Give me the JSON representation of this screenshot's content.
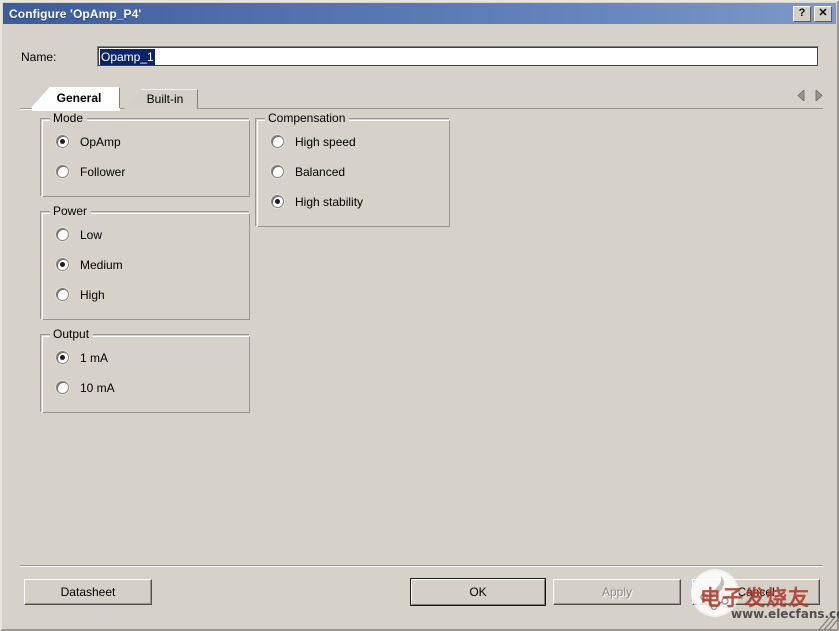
{
  "window": {
    "title": "Configure 'OpAmp_P4'",
    "help_button": "?",
    "close_button": "✕"
  },
  "name_field": {
    "label": "Name:",
    "value": "Opamp_1",
    "placeholder": "Opamp_1"
  },
  "tabs": [
    {
      "label": "General",
      "active": true
    },
    {
      "label": "Built-in",
      "active": false
    }
  ],
  "tab_nav": {
    "prev_icon": "left-triangle-icon",
    "next_icon": "right-triangle-icon"
  },
  "groups": {
    "mode": {
      "title": "Mode",
      "options": [
        {
          "label": "OpAmp",
          "selected": true
        },
        {
          "label": "Follower",
          "selected": false
        }
      ]
    },
    "power": {
      "title": "Power",
      "options": [
        {
          "label": "Low",
          "selected": false
        },
        {
          "label": "Medium",
          "selected": true
        },
        {
          "label": "High",
          "selected": false
        }
      ]
    },
    "output": {
      "title": "Output",
      "options": [
        {
          "label": "1 mA",
          "selected": true
        },
        {
          "label": "10 mA",
          "selected": false
        }
      ]
    },
    "compensation": {
      "title": "Compensation",
      "options": [
        {
          "label": "High speed",
          "selected": false
        },
        {
          "label": "Balanced",
          "selected": false
        },
        {
          "label": "High stability",
          "selected": true
        }
      ]
    }
  },
  "buttons": {
    "datasheet": "Datasheet",
    "ok": "OK",
    "apply": "Apply",
    "cancel": "Cancel"
  },
  "watermark": {
    "cn_text": "电子发烧友",
    "url_text": "www.elecfans.com"
  },
  "colors": {
    "titlebar_start": "#3c5c9c",
    "titlebar_end": "#7d99c9",
    "dialog_bg": "#d6d2ca",
    "selection_blue": "#0a246a",
    "watermark_red": "#b03a28"
  }
}
